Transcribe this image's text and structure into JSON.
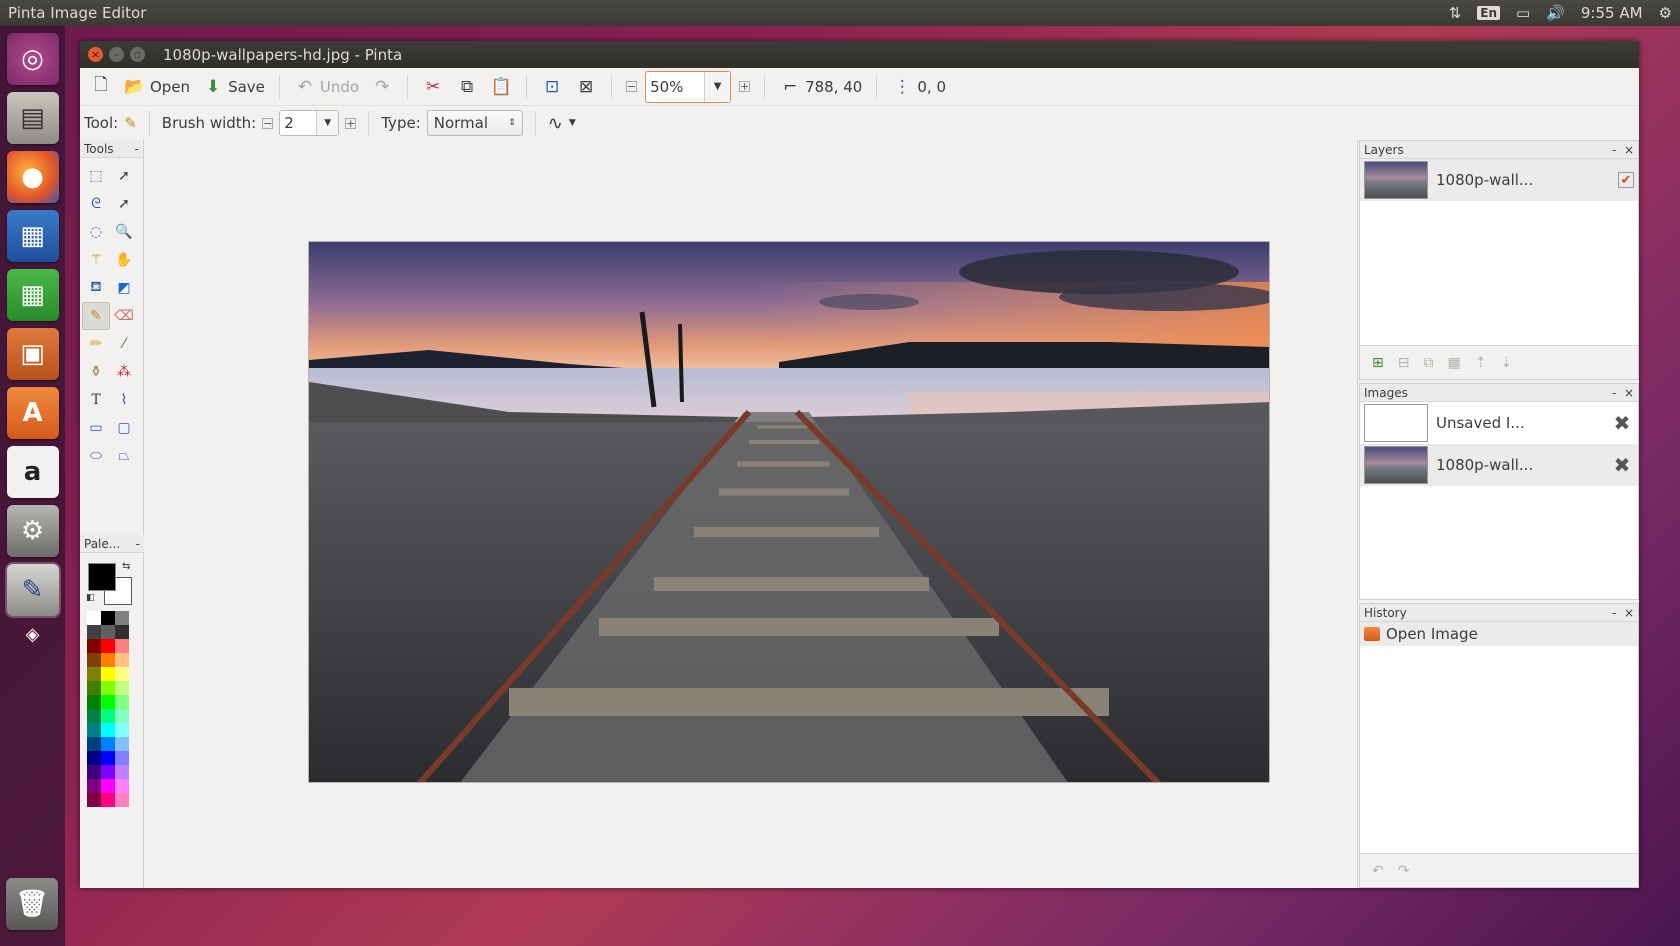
{
  "top_panel": {
    "app_name": "Pinta Image Editor",
    "keyboard_layout": "En",
    "time": "9:55 AM"
  },
  "window": {
    "title": "1080p-wallpapers-hd.jpg - Pinta"
  },
  "toolbar": {
    "open_label": "Open",
    "save_label": "Save",
    "undo_label": "Undo",
    "zoom_value": "50%",
    "image_size": "788, 40",
    "cursor_position": "0, 0"
  },
  "toolbar2": {
    "tool_label": "Tool:",
    "brush_width_label": "Brush width:",
    "brush_width_value": "2",
    "type_label": "Type:",
    "type_value": "Normal"
  },
  "tools_panel": {
    "title": "Tools"
  },
  "palette_panel": {
    "title": "Pale..."
  },
  "layers_panel": {
    "title": "Layers",
    "layers": [
      {
        "name": "1080p-wall...",
        "visible": true
      }
    ]
  },
  "images_panel": {
    "title": "Images",
    "images": [
      {
        "name": "Unsaved I..."
      },
      {
        "name": "1080p-wall..."
      }
    ]
  },
  "history_panel": {
    "title": "History",
    "items": [
      {
        "label": "Open Image"
      }
    ]
  },
  "colors": {
    "accent": "#e08a4e",
    "titlebar": "#3c3b37",
    "primary": "#000000",
    "secondary": "#ffffff"
  }
}
